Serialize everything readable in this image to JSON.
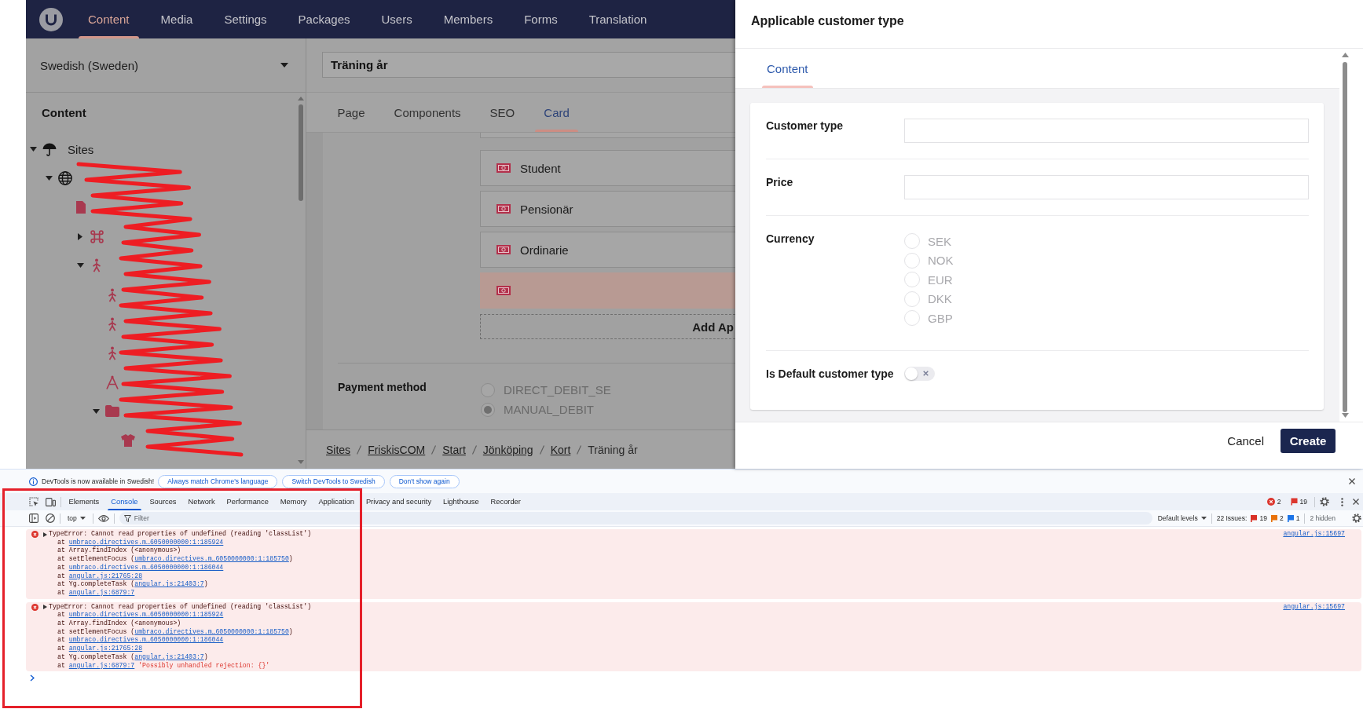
{
  "app_nav": {
    "items": [
      {
        "label": "Content",
        "selected": true
      },
      {
        "label": "Media",
        "selected": false
      },
      {
        "label": "Settings",
        "selected": false
      },
      {
        "label": "Packages",
        "selected": false
      },
      {
        "label": "Users",
        "selected": false
      },
      {
        "label": "Members",
        "selected": false
      },
      {
        "label": "Forms",
        "selected": false
      },
      {
        "label": "Translation",
        "selected": false
      }
    ]
  },
  "sidebar": {
    "language": "Swedish (Sweden)",
    "heading": "Content",
    "redaction_scribble": true,
    "tree": [
      {
        "label": "Sites",
        "kind": "root",
        "expanded": true,
        "children": [
          {
            "kind": "site",
            "expanded": true,
            "children": [
              {
                "kind": "page",
                "children": [
                  {
                    "kind": "section",
                    "expanded": false
                  },
                  {
                    "kind": "location",
                    "expanded": true,
                    "children": [
                      {
                        "kind": "location"
                      },
                      {
                        "kind": "location"
                      },
                      {
                        "kind": "location"
                      },
                      {
                        "kind": "activity"
                      },
                      {
                        "kind": "folder",
                        "expanded": true,
                        "children": [
                          {
                            "kind": "product"
                          }
                        ]
                      }
                    ]
                  }
                ]
              }
            ]
          }
        ]
      }
    ]
  },
  "editor": {
    "name": "Träning år",
    "tabs": [
      {
        "label": "Page",
        "selected": false
      },
      {
        "label": "Components",
        "selected": false
      },
      {
        "label": "SEO",
        "selected": false
      },
      {
        "label": "Card",
        "selected": true
      }
    ],
    "blocks": [
      {
        "label": "Student",
        "selected": false
      },
      {
        "label": "Pensionär",
        "selected": false
      },
      {
        "label": "Ordinarie",
        "selected": false
      },
      {
        "selected": true
      }
    ],
    "add_button": "Add Ap",
    "payment_method": {
      "label": "Payment method",
      "options": [
        {
          "label": "DIRECT_DEBIT_SE",
          "selected": false
        },
        {
          "label": "MANUAL_DEBIT",
          "selected": true
        }
      ]
    },
    "breadcrumb": [
      {
        "label": "Sites",
        "link": true
      },
      {
        "label": "FriskisCOM",
        "link": true
      },
      {
        "label": "Start",
        "link": true
      },
      {
        "label": "Jönköping",
        "link": true
      },
      {
        "label": "Kort",
        "link": true
      },
      {
        "label": "Träning år",
        "link": false
      }
    ]
  },
  "dialog": {
    "title": "Applicable customer type",
    "tabs": [
      {
        "label": "Content",
        "selected": true
      }
    ],
    "fields": [
      {
        "kind": "text",
        "label": "Customer type"
      },
      {
        "kind": "text",
        "label": "Price"
      },
      {
        "kind": "radio",
        "label": "Currency",
        "disabled": true,
        "options": [
          {
            "label": "SEK",
            "selected": false
          },
          {
            "label": "NOK",
            "selected": false
          },
          {
            "label": "EUR",
            "selected": false
          },
          {
            "label": "DKK",
            "selected": false
          },
          {
            "label": "GBP",
            "selected": false
          }
        ]
      },
      {
        "kind": "toggle",
        "label": "Is Default customer type",
        "on": false
      }
    ],
    "buttons": [
      {
        "label": "Cancel",
        "kind": "link"
      },
      {
        "label": "Create",
        "kind": "primary"
      }
    ]
  },
  "devtools": {
    "highlight_frame": true,
    "infobar": {
      "message": "DevTools is now available in Swedish!",
      "buttons": [
        "Always match Chrome's language",
        "Switch DevTools to Swedish",
        "Don't show again"
      ]
    },
    "tabs": [
      {
        "label": "Elements",
        "selected": false
      },
      {
        "label": "Console",
        "selected": true
      },
      {
        "label": "Sources",
        "selected": false
      },
      {
        "label": "Network",
        "selected": false
      },
      {
        "label": "Performance",
        "selected": false
      },
      {
        "label": "Memory",
        "selected": false
      },
      {
        "label": "Application",
        "selected": false
      },
      {
        "label": "Privacy and security",
        "selected": false
      },
      {
        "label": "Lighthouse",
        "selected": false
      },
      {
        "label": "Recorder",
        "selected": false
      }
    ],
    "counters": [
      {
        "kind": "error",
        "count": "2"
      },
      {
        "kind": "issue",
        "count": "19"
      }
    ],
    "toolbar": {
      "context": "top",
      "filter_placeholder": "Filter",
      "levels": "Default levels",
      "issues_label": "22 Issues:",
      "issue_badges": [
        {
          "count": "19",
          "color": "#d93025"
        },
        {
          "count": "2",
          "color": "#e8710a"
        },
        {
          "count": "1",
          "color": "#1a73e8"
        }
      ],
      "hidden": "2 hidden"
    },
    "messages": [
      {
        "kind": "error",
        "expanded": false,
        "text": "TypeError: Cannot read properties of undefined (reading 'classList')",
        "source": "angular.js:15697",
        "stack": [
          {
            "before": "at ",
            "link": "umbraco.directives.m…6050000000:1:185924"
          },
          {
            "before": "at Array.findIndex (<anonymous>)"
          },
          {
            "before": "at setElementFocus (",
            "link": "umbraco.directives.m…6050000000:1:185750",
            "after": ")"
          },
          {
            "before": "at ",
            "link": "umbraco.directives.m…6050000000:1:186044"
          },
          {
            "before": "at ",
            "link": "angular.js:21765:28"
          },
          {
            "before": "at Yg.completeTask (",
            "link": "angular.js:21403:7",
            "after": ")"
          },
          {
            "before": "at ",
            "link": "angular.js:6879:7"
          }
        ]
      },
      {
        "kind": "error",
        "expanded": false,
        "text": "TypeError: Cannot read properties of undefined (reading 'classList')",
        "source": "angular.js:15697",
        "stack": [
          {
            "before": "at ",
            "link": "umbraco.directives.m…6050000000:1:185924"
          },
          {
            "before": "at Array.findIndex (<anonymous>)"
          },
          {
            "before": "at setElementFocus (",
            "link": "umbraco.directives.m…6050000000:1:185750",
            "after": ")"
          },
          {
            "before": "at ",
            "link": "umbraco.directives.m…6050000000:1:186044"
          },
          {
            "before": "at ",
            "link": "angular.js:21765:28"
          },
          {
            "before": "at Yg.completeTask (",
            "link": "angular.js:21403:7",
            "after": ")"
          },
          {
            "before": "at ",
            "link": "angular.js:6879:7",
            "note": "'Possibly unhandled rejection: {}'"
          }
        ]
      }
    ]
  }
}
